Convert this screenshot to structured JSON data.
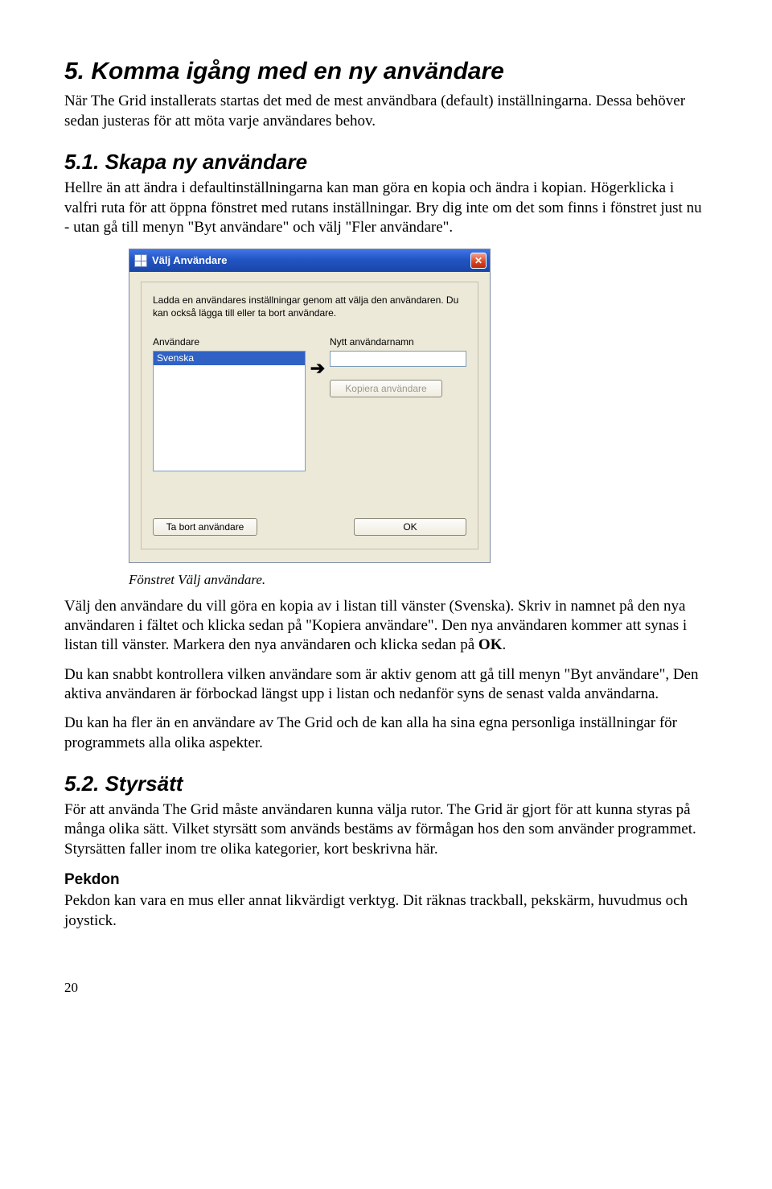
{
  "h1": "5. Komma igång med en ny användare",
  "p1": "När The Grid installerats startas det med de mest användbara (default) inställningarna. Dessa behöver sedan justeras för att möta varje användares behov.",
  "h2a": "5.1. Skapa ny användare",
  "p2": "Hellre än att ändra i defaultinställningarna kan man göra en kopia och ändra i kopian. Högerklicka i valfri ruta för att öppna fönstret med rutans inställningar. Bry dig inte om det som finns i fönstret just nu - utan gå till menyn \"Byt användare\" och välj \"Fler användare\".",
  "dialog": {
    "title": "Välj Användare",
    "close_glyph": "✕",
    "intro": "Ladda en användares inställningar genom att välja den användaren. Du kan också lägga till eller ta bort användare.",
    "left_label": "Användare",
    "right_label": "Nytt användarnamn",
    "list_item": "Svenska",
    "arrow_glyph": "➔",
    "copy_btn": "Kopiera användare",
    "remove_btn": "Ta bort användare",
    "ok_btn": "OK"
  },
  "caption": "Fönstret Välj användare.",
  "p3a": "Välj den användare du vill göra en kopia av i listan till vänster (Svenska). Skriv in namnet på den nya användaren i fältet och klicka sedan på \"Kopiera användare\". Den nya användaren kommer att synas i listan till vänster. Markera den nya användaren och klicka sedan på ",
  "p3b": "OK",
  "p3c": ".",
  "p4": "Du kan snabbt kontrollera vilken användare som är aktiv genom att gå till menyn \"Byt användare\", Den aktiva användaren är förbockad längst upp i listan och nedanför syns de senast valda användarna.",
  "p5": "Du kan ha fler än en användare av The Grid och de kan alla ha sina egna personliga inställningar för programmets alla olika aspekter.",
  "h2b": "5.2. Styrsätt",
  "p6": "För att använda The Grid måste användaren kunna välja rutor. The Grid är gjort för att kunna styras på många olika sätt. Vilket styrsätt som används bestäms av förmågan hos den som använder programmet. Styrsätten faller inom tre olika kategorier, kort beskrivna här.",
  "h3a": "Pekdon",
  "p7": "Pekdon kan vara en mus eller annat likvärdigt verktyg. Dit räknas trackball, pekskärm, huvudmus och joystick.",
  "page_num": "20"
}
